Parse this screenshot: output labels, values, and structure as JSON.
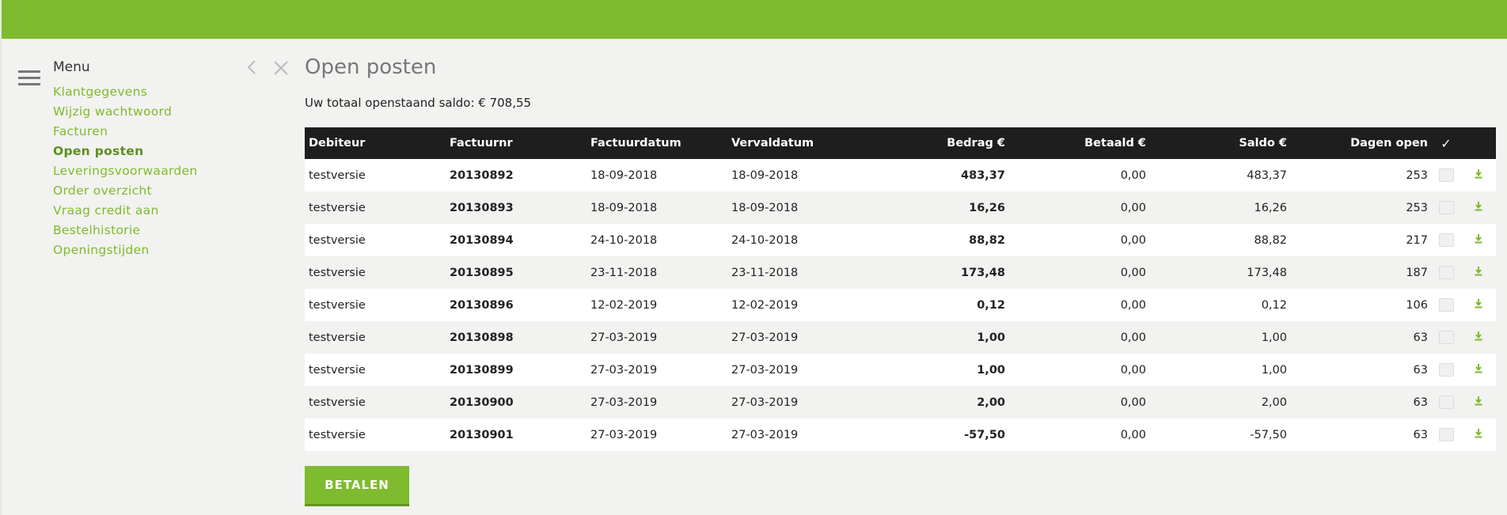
{
  "colors": {
    "brand": "#7fbb2e",
    "header_bg": "#1e1e1e",
    "page_bg": "#f2f2f0"
  },
  "sidebar": {
    "title": "Menu",
    "menu_icon": "hamburger-icon",
    "items": [
      {
        "label": "Klantgegevens",
        "active": false
      },
      {
        "label": "Wijzig wachtwoord",
        "active": false
      },
      {
        "label": "Facturen",
        "active": false
      },
      {
        "label": "Open posten",
        "active": true
      },
      {
        "label": "Leveringsvoorwaarden",
        "active": false
      },
      {
        "label": "Order overzicht",
        "active": false
      },
      {
        "label": "Vraag credit aan",
        "active": false
      },
      {
        "label": "Bestelhistorie",
        "active": false
      },
      {
        "label": "Openingstijden",
        "active": false
      }
    ]
  },
  "nav": {
    "back_icon": "chevron-left-icon",
    "close_icon": "close-icon"
  },
  "main": {
    "title": "Open posten",
    "saldo_text": "Uw totaal openstaand saldo: € 708,55",
    "pay_button": "BETALEN"
  },
  "table": {
    "headers": {
      "debiteur": "Debiteur",
      "factuurnr": "Factuurnr",
      "factuurdatum": "Factuurdatum",
      "vervaldatum": "Vervaldatum",
      "bedrag": "Bedrag €",
      "betaald": "Betaald €",
      "saldo": "Saldo €",
      "dagen": "Dagen open",
      "check": "✓"
    },
    "rows": [
      {
        "debiteur": "testversie",
        "factuurnr": "20130892",
        "factuurdatum": "18-09-2018",
        "vervaldatum": "18-09-2018",
        "bedrag": "483,37",
        "betaald": "0,00",
        "saldo": "483,37",
        "dagen": "253"
      },
      {
        "debiteur": "testversie",
        "factuurnr": "20130893",
        "factuurdatum": "18-09-2018",
        "vervaldatum": "18-09-2018",
        "bedrag": "16,26",
        "betaald": "0,00",
        "saldo": "16,26",
        "dagen": "253"
      },
      {
        "debiteur": "testversie",
        "factuurnr": "20130894",
        "factuurdatum": "24-10-2018",
        "vervaldatum": "24-10-2018",
        "bedrag": "88,82",
        "betaald": "0,00",
        "saldo": "88,82",
        "dagen": "217"
      },
      {
        "debiteur": "testversie",
        "factuurnr": "20130895",
        "factuurdatum": "23-11-2018",
        "vervaldatum": "23-11-2018",
        "bedrag": "173,48",
        "betaald": "0,00",
        "saldo": "173,48",
        "dagen": "187"
      },
      {
        "debiteur": "testversie",
        "factuurnr": "20130896",
        "factuurdatum": "12-02-2019",
        "vervaldatum": "12-02-2019",
        "bedrag": "0,12",
        "betaald": "0,00",
        "saldo": "0,12",
        "dagen": "106"
      },
      {
        "debiteur": "testversie",
        "factuurnr": "20130898",
        "factuurdatum": "27-03-2019",
        "vervaldatum": "27-03-2019",
        "bedrag": "1,00",
        "betaald": "0,00",
        "saldo": "1,00",
        "dagen": "63"
      },
      {
        "debiteur": "testversie",
        "factuurnr": "20130899",
        "factuurdatum": "27-03-2019",
        "vervaldatum": "27-03-2019",
        "bedrag": "1,00",
        "betaald": "0,00",
        "saldo": "1,00",
        "dagen": "63"
      },
      {
        "debiteur": "testversie",
        "factuurnr": "20130900",
        "factuurdatum": "27-03-2019",
        "vervaldatum": "27-03-2019",
        "bedrag": "2,00",
        "betaald": "0,00",
        "saldo": "2,00",
        "dagen": "63"
      },
      {
        "debiteur": "testversie",
        "factuurnr": "20130901",
        "factuurdatum": "27-03-2019",
        "vervaldatum": "27-03-2019",
        "bedrag": "-57,50",
        "betaald": "0,00",
        "saldo": "-57,50",
        "dagen": "63"
      }
    ],
    "row_icons": {
      "download": "download-icon"
    }
  }
}
